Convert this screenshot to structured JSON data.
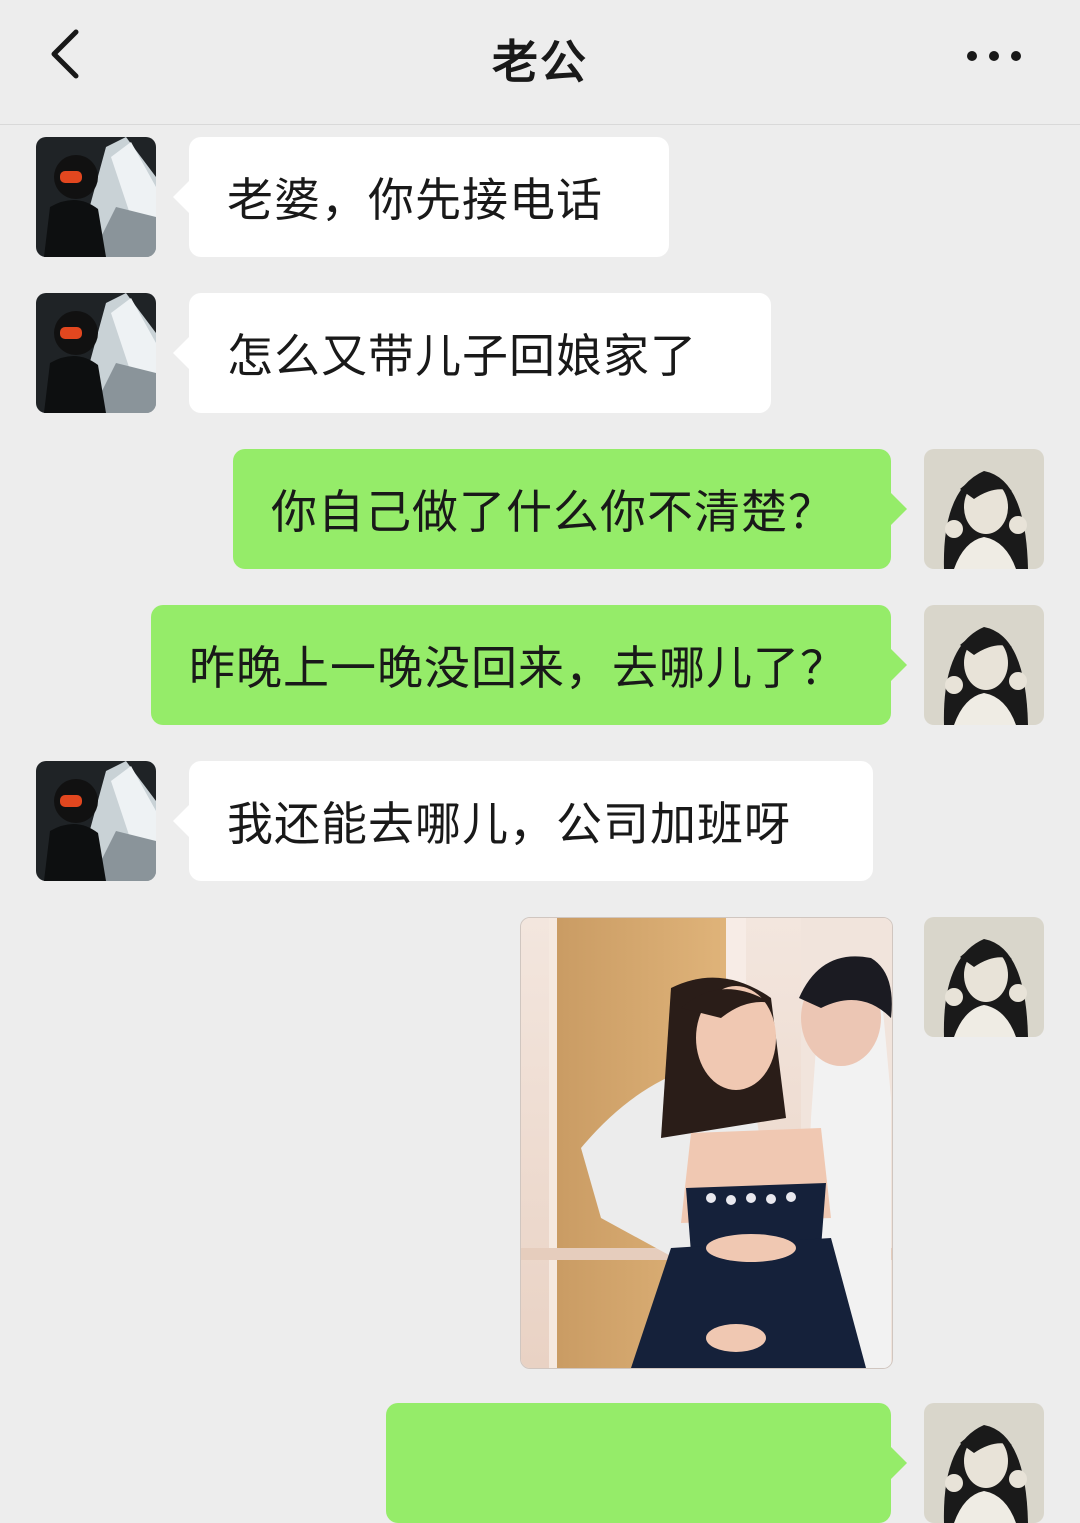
{
  "header": {
    "title": "老公",
    "back_icon": "chevron-left-icon",
    "more_icon": "ellipsis-icon"
  },
  "messages": [
    {
      "side": "in",
      "text": "老婆，你先接电话"
    },
    {
      "side": "in",
      "text": "怎么又带儿子回娘家了"
    },
    {
      "side": "out",
      "text": "你自己做了什么你不清楚？"
    },
    {
      "side": "out",
      "text": "昨晚上一晚没回来，去哪儿了？"
    },
    {
      "side": "in",
      "text": "我还能去哪儿，公司加班呀"
    },
    {
      "side": "out",
      "type": "image",
      "text": ""
    },
    {
      "side": "out",
      "text": ""
    }
  ],
  "colors": {
    "background": "#ededed",
    "incoming_bubble": "#ffffff",
    "outgoing_bubble": "#95ec69"
  }
}
